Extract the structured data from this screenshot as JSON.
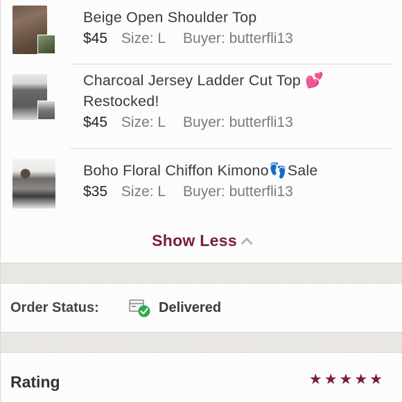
{
  "items": [
    {
      "title": "Beige Open Shoulder Top",
      "price": "$45",
      "size_label": "Size:",
      "size": "L",
      "buyer_label": "Buyer:",
      "buyer": "butterfli13",
      "thumb_icon": "beige-top-photo"
    },
    {
      "title_line1": "Charcoal Jersey Ladder Cut Top 💕",
      "title_line2": "Restocked!",
      "price": "$45",
      "size_label": "Size:",
      "size": "L",
      "buyer_label": "Buyer:",
      "buyer": "butterfli13",
      "thumb_icon": "charcoal-top-photo"
    },
    {
      "title": "Boho Floral Chiffon Kimono👣Sale",
      "price": "$35",
      "size_label": "Size:",
      "size": "L",
      "buyer_label": "Buyer:",
      "buyer": "butterfli13",
      "thumb_icon": "kimono-photo"
    }
  ],
  "show_less": {
    "label": "Show Less",
    "icon": "chevron-up-icon"
  },
  "order_status": {
    "label": "Order Status:",
    "value": "Delivered",
    "icon": "delivered-box-icon",
    "check_color": "#2eaa4a"
  },
  "rating": {
    "label": "Rating",
    "stars": 5,
    "star_color": "#7a1f36"
  },
  "colors": {
    "accent": "#7a1f36",
    "band": "#e9e6e1"
  }
}
